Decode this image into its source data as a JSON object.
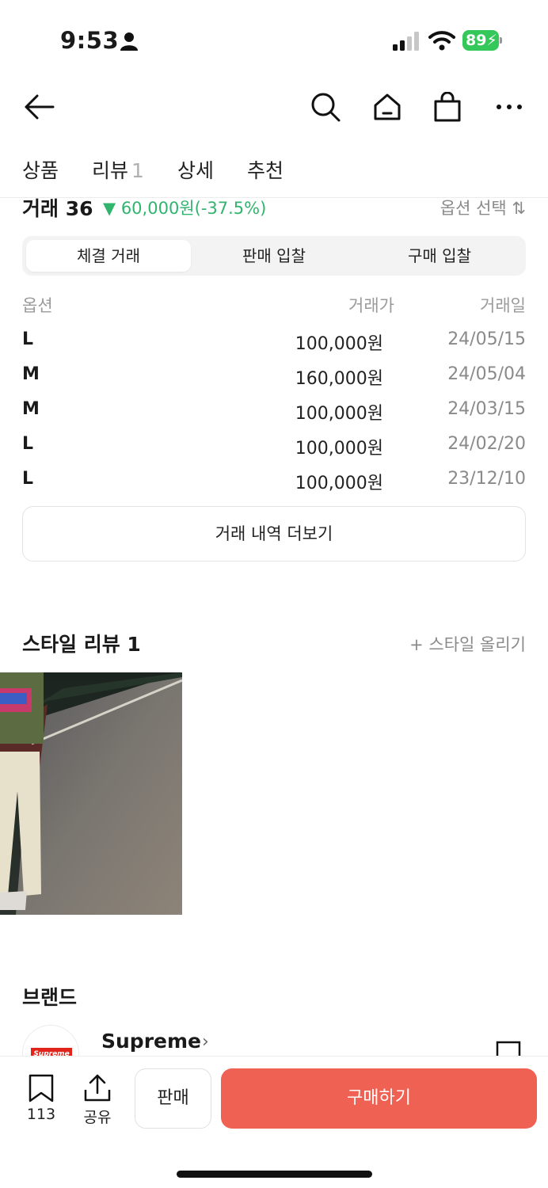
{
  "status_bar": {
    "time": "9:53",
    "battery": "89"
  },
  "tabs": [
    {
      "label": "상품"
    },
    {
      "label": "리뷰",
      "count": "1"
    },
    {
      "label": "상세"
    },
    {
      "label": "추천"
    }
  ],
  "trade": {
    "title": "거래 36",
    "change": "▼ 60,000원(-37.5%)",
    "change_color": "#31b46e",
    "option_select": "옵션 선택 ⇅",
    "segments": [
      "체결 거래",
      "판매 입찰",
      "구매 입찰"
    ],
    "active_segment": "체결 거래",
    "headers": {
      "option": "옵션",
      "price": "거래가",
      "date": "거래일"
    },
    "rows": [
      {
        "option": "L",
        "price": "100,000원",
        "date": "24/05/15"
      },
      {
        "option": "M",
        "price": "160,000원",
        "date": "24/05/04"
      },
      {
        "option": "M",
        "price": "100,000원",
        "date": "24/03/15"
      },
      {
        "option": "L",
        "price": "100,000원",
        "date": "24/02/20"
      },
      {
        "option": "L",
        "price": "100,000원",
        "date": "23/12/10"
      }
    ],
    "more_label": "거래 내역 더보기"
  },
  "style_review": {
    "title": "스타일 리뷰 1",
    "upload_label": "+ 스타일 올리기"
  },
  "brand": {
    "section_title": "브랜드",
    "name": "Supreme",
    "chevron": "›",
    "logo_text": "Supreme"
  },
  "bottom_bar": {
    "bookmark_count": "113",
    "share_label": "공유",
    "sell_label": "판매",
    "buy_label": "구매하기",
    "buy_color": "#ef6253"
  },
  "icons": {
    "back": "back-arrow-icon",
    "search": "search-icon",
    "home": "home-icon",
    "bag": "shopping-bag-icon",
    "more": "more-dots-icon"
  }
}
